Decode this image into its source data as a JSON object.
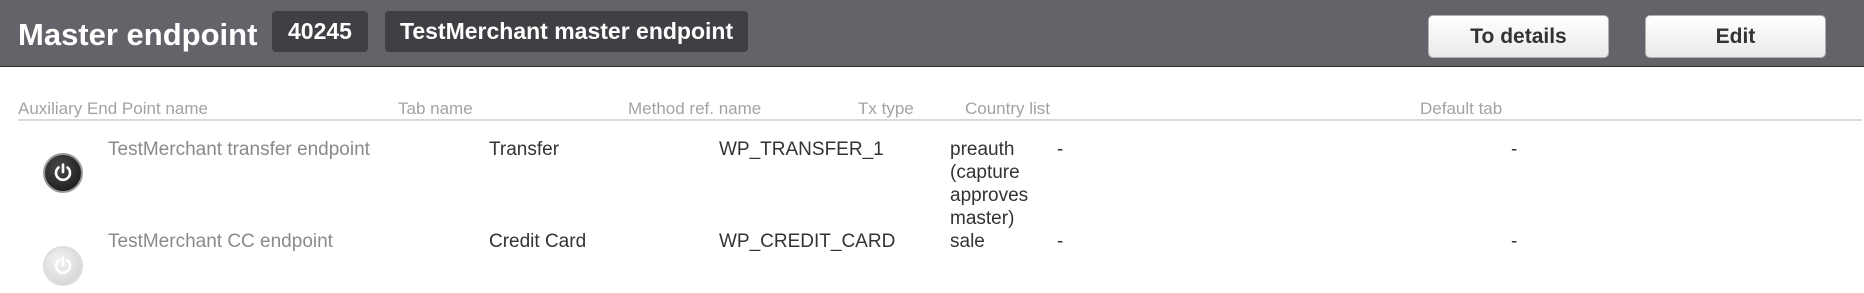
{
  "header": {
    "title": "Master endpoint",
    "id": "40245",
    "name": "TestMerchant master endpoint",
    "details_button": "To details",
    "edit_button": "Edit"
  },
  "columns": [
    "Auxiliary End Point name",
    "Tab name",
    "Method ref. name",
    "Tx type",
    "Country list",
    "Default tab"
  ],
  "rows": [
    {
      "status": "enabled",
      "name": "TestMerchant transfer endpoint",
      "tab": "Transfer",
      "method": "WP_TRANSFER_1",
      "tx_type": "preauth (capture approves master)",
      "country": "-",
      "default_tab": "-"
    },
    {
      "status": "disabled",
      "name": "TestMerchant CC endpoint",
      "tab": "Credit Card",
      "method": "WP_CREDIT_CARD",
      "tx_type": "sale",
      "country": "-",
      "default_tab": "-"
    }
  ]
}
